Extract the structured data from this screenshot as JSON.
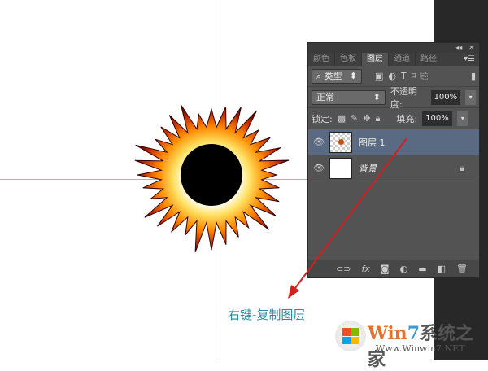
{
  "panel": {
    "tabs": [
      "颜色",
      "色板",
      "图层",
      "通道",
      "路径"
    ],
    "active_tab": "图层",
    "filter_label": "类型",
    "blend_mode": "正常",
    "opacity_label": "不透明度:",
    "opacity_value": "100%",
    "lock_label": "锁定:",
    "fill_label": "填充:",
    "fill_value": "100%",
    "layers": [
      {
        "name": "图层 1",
        "selected": true
      },
      {
        "name": "背景",
        "locked": true
      }
    ],
    "footer_icons": [
      "link-icon",
      "fx-icon",
      "mask-icon",
      "adjustment-icon",
      "folder-icon",
      "new-layer-icon",
      "trash-icon"
    ]
  },
  "caption": "右键-复制图层",
  "watermark": {
    "title_a": "Win",
    "title_b": "7",
    "title_c": "系统之家",
    "url": "Www.Winwin7.NET"
  },
  "colors": {
    "guide": "#5fd6e6",
    "arrow": "#d02020",
    "caption": "#2a8a9c"
  }
}
